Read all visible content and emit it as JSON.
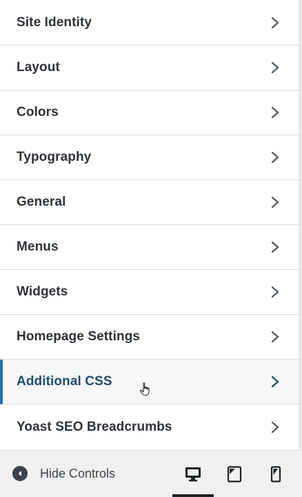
{
  "menu": {
    "items": [
      {
        "label": "Site Identity"
      },
      {
        "label": "Layout"
      },
      {
        "label": "Colors"
      },
      {
        "label": "Typography"
      },
      {
        "label": "General"
      },
      {
        "label": "Menus"
      },
      {
        "label": "Widgets"
      },
      {
        "label": "Homepage Settings"
      },
      {
        "label": "Additional CSS",
        "active": true
      },
      {
        "label": "Yoast SEO Breadcrumbs"
      }
    ]
  },
  "footer": {
    "hide_controls_label": "Hide Controls",
    "devices": [
      {
        "icon": "desktop-icon",
        "active": true
      },
      {
        "icon": "tablet-icon",
        "active": false
      },
      {
        "icon": "mobile-icon",
        "active": false
      }
    ]
  },
  "colors": {
    "accent": "#2271b1",
    "text": "#2c3338",
    "active_text": "#1d4e6b",
    "border": "#dcdcde",
    "footer_bg": "#f0f0f1"
  }
}
